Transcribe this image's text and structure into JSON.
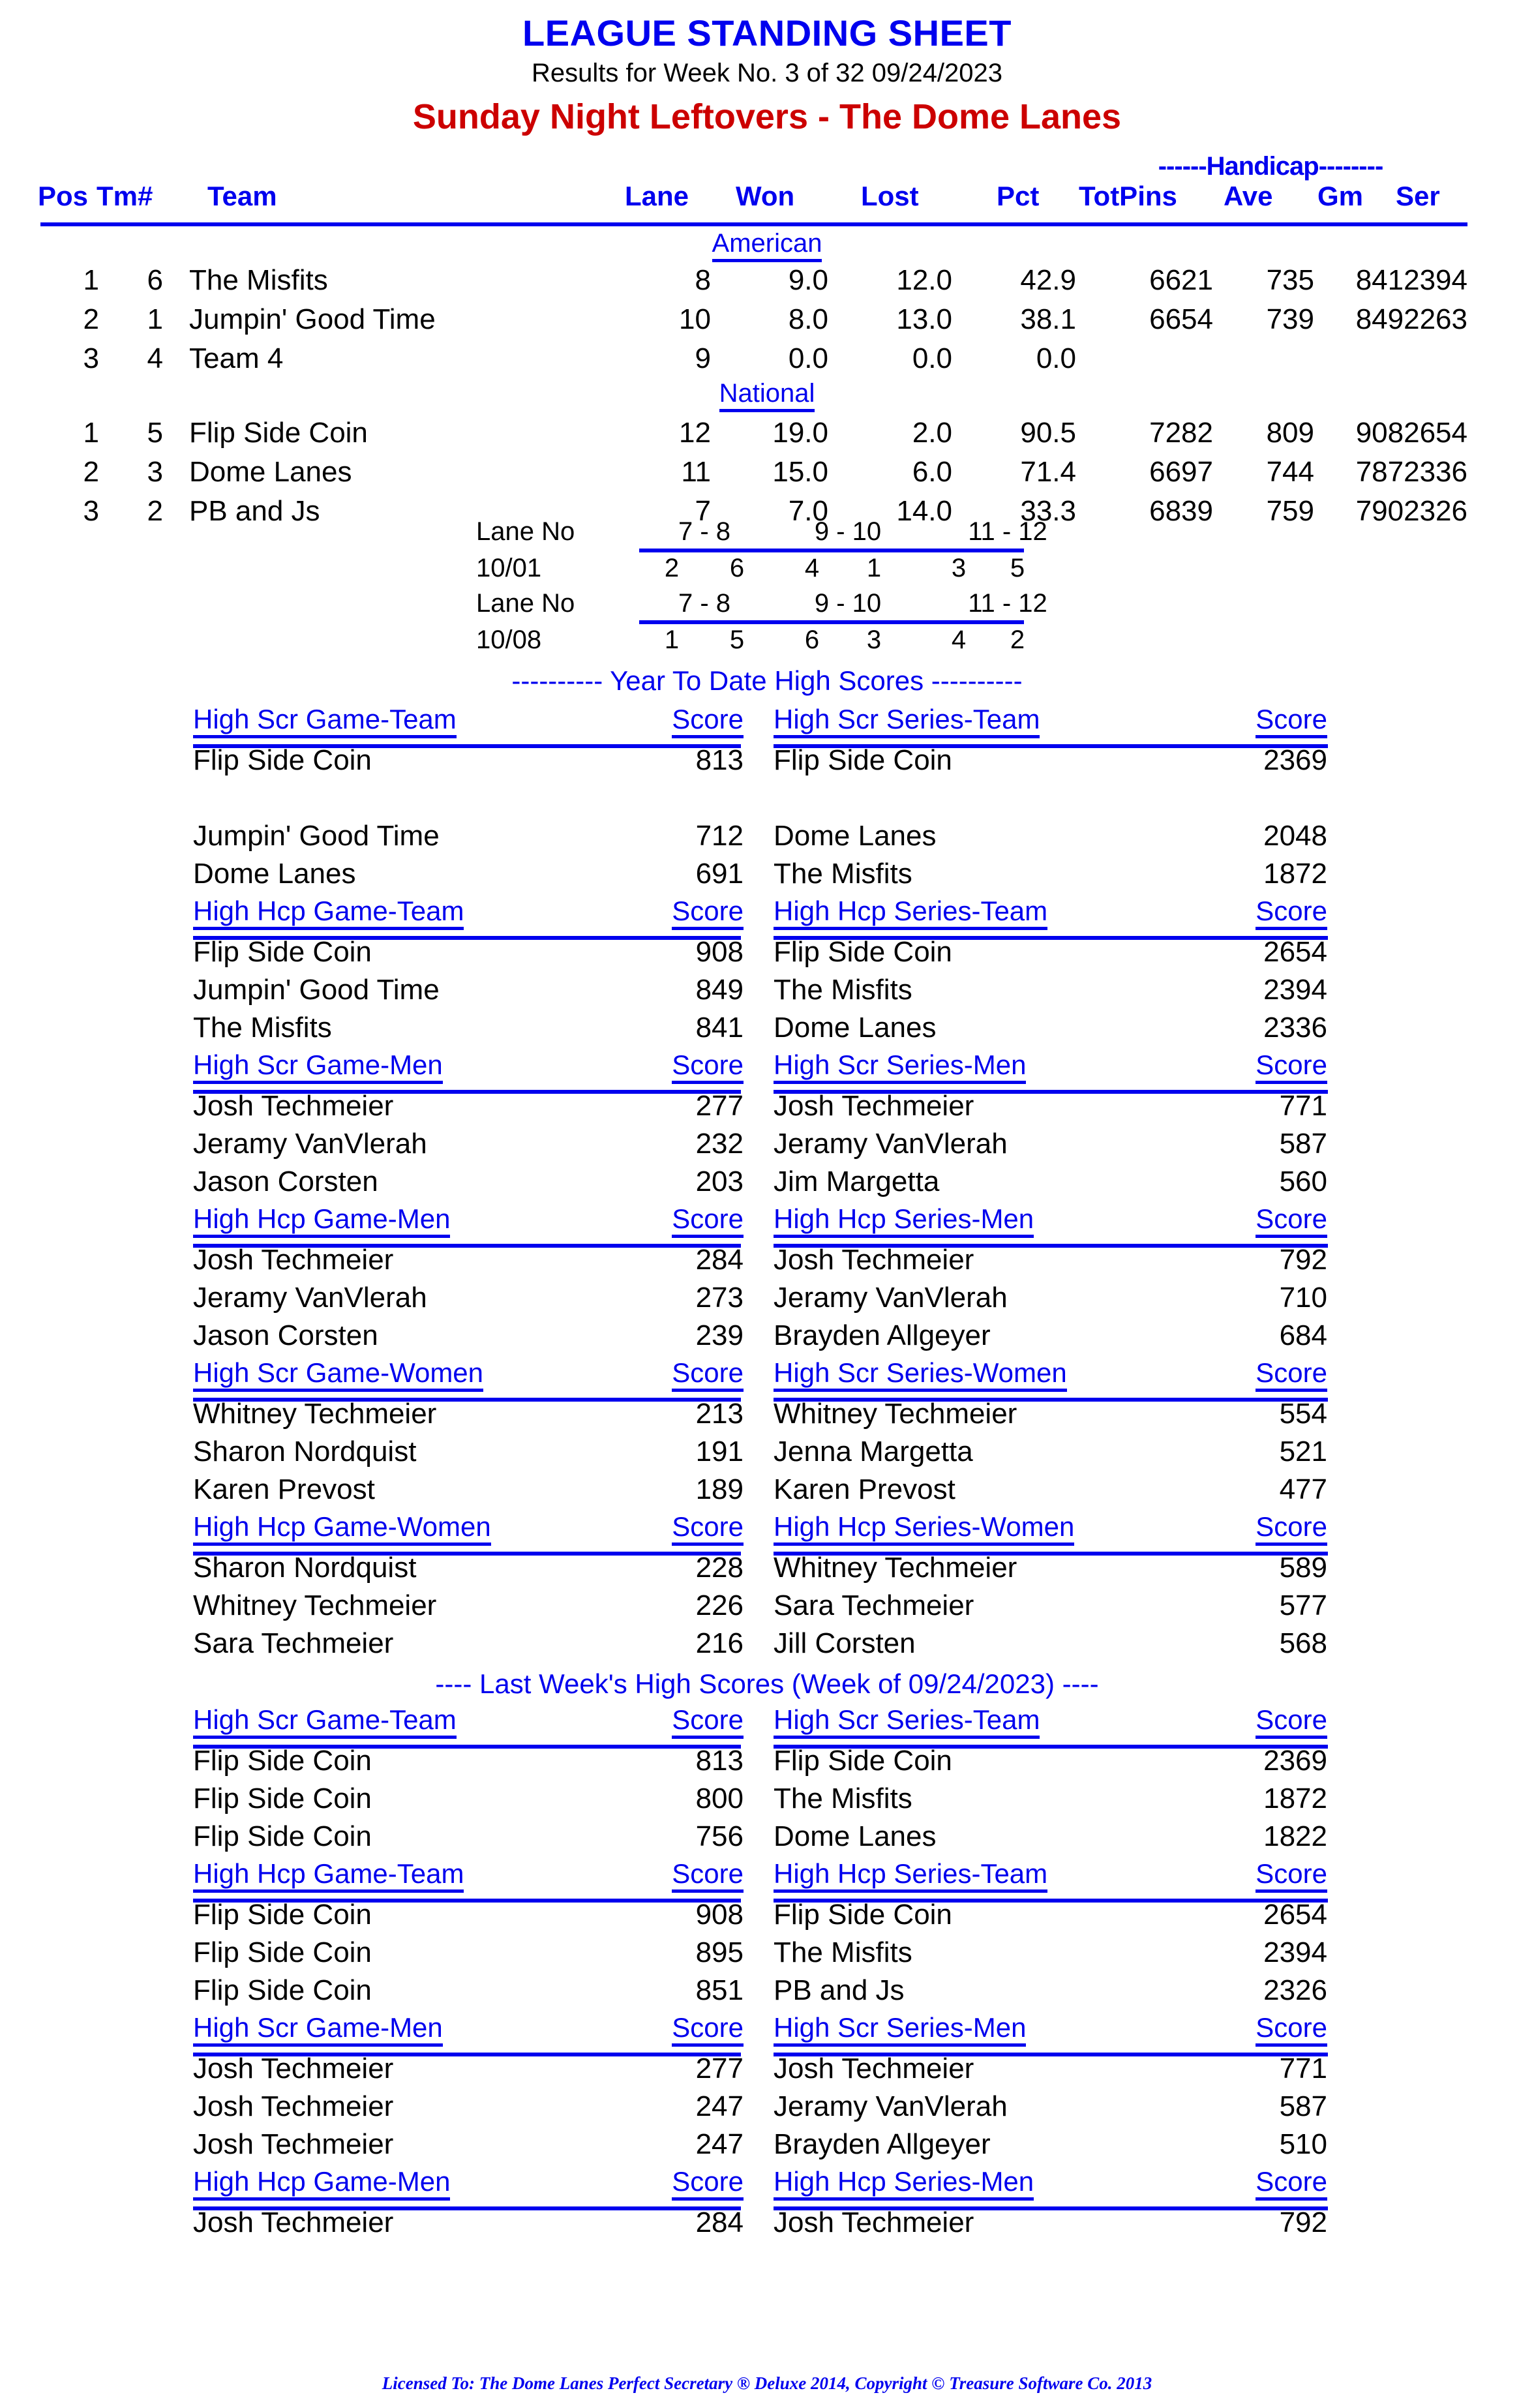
{
  "header": {
    "title": "LEAGUE STANDING SHEET",
    "subtitle": "Results for Week No. 3 of 32    09/24/2023",
    "league": "Sunday Night Leftovers - The Dome Lanes"
  },
  "standings": {
    "handicap_label": "------Handicap--------",
    "columns": {
      "pos": "Pos",
      "tm": "Tm#",
      "team": "Team",
      "lane": "Lane",
      "won": "Won",
      "lost": "Lost",
      "pct": "Pct",
      "totpins": "TotPins",
      "ave": "Ave",
      "gm": "Gm",
      "ser": "Ser"
    },
    "divisions": [
      {
        "name": "American",
        "rows": [
          {
            "pos": "1",
            "tm": "6",
            "team": "The Misfits",
            "lane": "8",
            "won": "9.0",
            "lost": "12.0",
            "pct": "42.9",
            "totpins": "6621",
            "ave": "735",
            "gmser": "8412394"
          },
          {
            "pos": "2",
            "tm": "1",
            "team": "Jumpin' Good Time",
            "lane": "10",
            "won": "8.0",
            "lost": "13.0",
            "pct": "38.1",
            "totpins": "6654",
            "ave": "739",
            "gmser": "8492263"
          },
          {
            "pos": "3",
            "tm": "4",
            "team": "Team 4",
            "lane": "9",
            "won": "0.0",
            "lost": "0.0",
            "pct": "0.0",
            "totpins": "",
            "ave": "",
            "gmser": ""
          }
        ]
      },
      {
        "name": "National",
        "rows": [
          {
            "pos": "1",
            "tm": "5",
            "team": "Flip Side Coin",
            "lane": "12",
            "won": "19.0",
            "lost": "2.0",
            "pct": "90.5",
            "totpins": "7282",
            "ave": "809",
            "gmser": "9082654"
          },
          {
            "pos": "2",
            "tm": "3",
            "team": "Dome Lanes",
            "lane": "11",
            "won": "15.0",
            "lost": "6.0",
            "pct": "71.4",
            "totpins": "6697",
            "ave": "744",
            "gmser": "7872336"
          },
          {
            "pos": "3",
            "tm": "2",
            "team": "PB and Js",
            "lane": "7",
            "won": "7.0",
            "lost": "14.0",
            "pct": "33.3",
            "totpins": "6839",
            "ave": "759",
            "gmser": "7902326"
          }
        ]
      }
    ]
  },
  "lane_schedule": {
    "lane_label": "Lane No",
    "pair1": "7 -  8",
    "pair2": "9 - 10",
    "pair3": "11 - 12",
    "weeks": [
      {
        "date": "10/01",
        "a1": "2",
        "a2": "6",
        "b1": "4",
        "b2": "1",
        "c1": "3",
        "c2": "5"
      },
      {
        "date": "10/08",
        "a1": "1",
        "a2": "5",
        "b1": "6",
        "b2": "3",
        "c1": "4",
        "c2": "2"
      }
    ]
  },
  "ytd": {
    "banner": "---------- Year To Date High Scores ----------",
    "score_label": "Score",
    "blocks": [
      {
        "left_title": "High Scr Game-Team",
        "right_title": "High Scr Series-Team",
        "rows": [
          {
            "n1": "Flip Side Coin",
            "s1": "813",
            "n2": "Flip Side Coin",
            "s2": "2369"
          },
          {
            "n1": "",
            "s1": "",
            "n2": "",
            "s2": ""
          },
          {
            "n1": "Jumpin' Good Time",
            "s1": "712",
            "n2": "Dome Lanes",
            "s2": "2048"
          },
          {
            "n1": "Dome Lanes",
            "s1": "691",
            "n2": "The Misfits",
            "s2": "1872"
          }
        ]
      },
      {
        "left_title": "High Hcp Game-Team",
        "right_title": "High Hcp Series-Team",
        "rows": [
          {
            "n1": "Flip Side Coin",
            "s1": "908",
            "n2": "Flip Side Coin",
            "s2": "2654"
          },
          {
            "n1": "Jumpin' Good Time",
            "s1": "849",
            "n2": "The Misfits",
            "s2": "2394"
          },
          {
            "n1": "The Misfits",
            "s1": "841",
            "n2": "Dome Lanes",
            "s2": "2336"
          }
        ]
      },
      {
        "left_title": "High Scr Game-Men",
        "right_title": "High Scr Series-Men",
        "rows": [
          {
            "n1": "Josh Techmeier",
            "s1": "277",
            "n2": "Josh Techmeier",
            "s2": "771"
          },
          {
            "n1": "Jeramy VanVlerah",
            "s1": "232",
            "n2": "Jeramy VanVlerah",
            "s2": "587"
          },
          {
            "n1": "Jason Corsten",
            "s1": "203",
            "n2": "Jim Margetta",
            "s2": "560"
          }
        ]
      },
      {
        "left_title": "High Hcp Game-Men",
        "right_title": "High Hcp Series-Men",
        "rows": [
          {
            "n1": "Josh Techmeier",
            "s1": "284",
            "n2": "Josh Techmeier",
            "s2": "792"
          },
          {
            "n1": "Jeramy VanVlerah",
            "s1": "273",
            "n2": "Jeramy VanVlerah",
            "s2": "710"
          },
          {
            "n1": "Jason Corsten",
            "s1": "239",
            "n2": "Brayden Allgeyer",
            "s2": "684"
          }
        ]
      },
      {
        "left_title": "High Scr Game-Women",
        "right_title": "High Scr Series-Women",
        "rows": [
          {
            "n1": "Whitney Techmeier",
            "s1": "213",
            "n2": "Whitney Techmeier",
            "s2": "554"
          },
          {
            "n1": "Sharon Nordquist",
            "s1": "191",
            "n2": "Jenna Margetta",
            "s2": "521"
          },
          {
            "n1": "Karen Prevost",
            "s1": "189",
            "n2": "Karen Prevost",
            "s2": "477"
          }
        ]
      },
      {
        "left_title": "High Hcp Game-Women",
        "right_title": "High Hcp Series-Women",
        "rows": [
          {
            "n1": "Sharon Nordquist",
            "s1": "228",
            "n2": "Whitney Techmeier",
            "s2": "589"
          },
          {
            "n1": "Whitney Techmeier",
            "s1": "226",
            "n2": "Sara Techmeier",
            "s2": "577"
          },
          {
            "n1": "Sara Techmeier",
            "s1": "216",
            "n2": "Jill Corsten",
            "s2": "568"
          }
        ]
      }
    ]
  },
  "last_week": {
    "banner": "----  Last Week's High Scores   (Week of 09/24/2023)  ----",
    "score_label": "Score",
    "blocks": [
      {
        "left_title": "High Scr Game-Team",
        "right_title": "High Scr Series-Team",
        "rows": [
          {
            "n1": "Flip Side Coin",
            "s1": "813",
            "n2": "Flip Side Coin",
            "s2": "2369"
          },
          {
            "n1": "Flip Side Coin",
            "s1": "800",
            "n2": "The Misfits",
            "s2": "1872"
          },
          {
            "n1": "Flip Side Coin",
            "s1": "756",
            "n2": "Dome Lanes",
            "s2": "1822"
          }
        ]
      },
      {
        "left_title": "High Hcp Game-Team",
        "right_title": "High Hcp Series-Team",
        "rows": [
          {
            "n1": "Flip Side Coin",
            "s1": "908",
            "n2": "Flip Side Coin",
            "s2": "2654"
          },
          {
            "n1": "Flip Side Coin",
            "s1": "895",
            "n2": "The Misfits",
            "s2": "2394"
          },
          {
            "n1": "Flip Side Coin",
            "s1": "851",
            "n2": "PB and Js",
            "s2": "2326"
          }
        ]
      },
      {
        "left_title": "High Scr Game-Men",
        "right_title": "High Scr Series-Men",
        "rows": [
          {
            "n1": "Josh Techmeier",
            "s1": "277",
            "n2": "Josh Techmeier",
            "s2": "771"
          },
          {
            "n1": "Josh Techmeier",
            "s1": "247",
            "n2": "Jeramy VanVlerah",
            "s2": "587"
          },
          {
            "n1": "Josh Techmeier",
            "s1": "247",
            "n2": "Brayden Allgeyer",
            "s2": "510"
          }
        ]
      },
      {
        "left_title": "High Hcp Game-Men",
        "right_title": "High Hcp Series-Men",
        "rows": [
          {
            "n1": "Josh Techmeier",
            "s1": "284",
            "n2": "Josh Techmeier",
            "s2": "792"
          }
        ]
      }
    ]
  },
  "footer": {
    "text": "Licensed To: The Dome Lanes    Perfect Secretary ® Deluxe  2014, Copyright © Treasure Software Co. 2013"
  },
  "colors": {
    "accent_blue": "#0000ee",
    "league_red": "#cc0000",
    "text_black": "#000000"
  }
}
